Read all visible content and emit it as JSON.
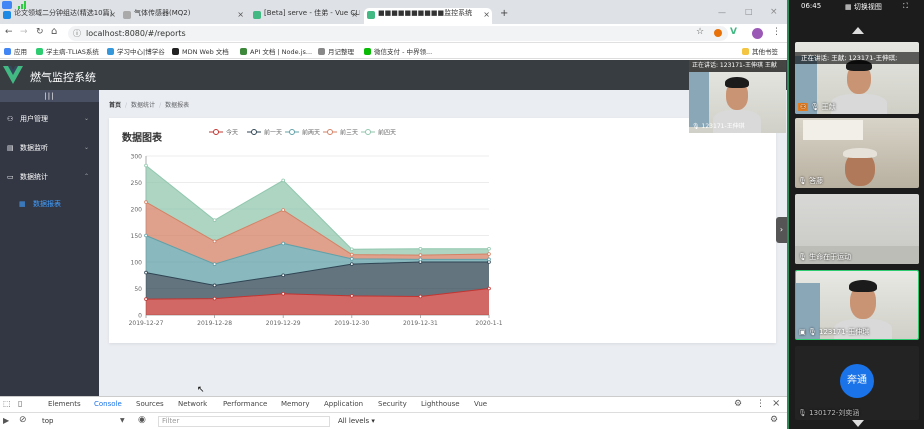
{
  "browser": {
    "tabs": [
      {
        "label": "论文领域二分钟组达(精选10篇)"
      },
      {
        "label": "气体传感器(MQ2)"
      },
      {
        "label": "[Beta] serve - 佳弟 - Vue CLI"
      },
      {
        "label": "■■■■■■■■■■监控系统"
      }
    ],
    "new_tab": "+",
    "url": "localhost:8080/#/reports",
    "bookmarks": [
      "应用",
      "学主病-TLIAS系统",
      "学习中心|博学谷",
      "MDN Web 文档",
      "API 文档 | Node.js...",
      "月记整理",
      "微信支付 - 中界领...",
      "其他书签"
    ]
  },
  "app": {
    "title": "燃气监控系统",
    "collapse_label": "|||",
    "menu": [
      {
        "label": "用户管理",
        "icon": "user-icon"
      },
      {
        "label": "数据监听",
        "icon": "document-icon"
      },
      {
        "label": "数据统计",
        "icon": "chat-icon"
      }
    ],
    "submenu_active": "数据报表",
    "breadcrumb": [
      "首页",
      "数据统计",
      "数据报表"
    ],
    "card_title": "数据图表"
  },
  "chart_data": {
    "type": "area",
    "title": "数据图表",
    "stacked": true,
    "categories": [
      "2019-12-27",
      "2019-12-28",
      "2019-12-29",
      "2019-12-30",
      "2019-12-31",
      "2020-1-1"
    ],
    "ylim": [
      0,
      300
    ],
    "yticks": [
      0,
      50,
      100,
      150,
      200,
      250,
      300
    ],
    "legend_position": "top-center",
    "series": [
      {
        "name": "今天",
        "color": "#c23531",
        "values": [
          30,
          31,
          40,
          36,
          35,
          50
        ]
      },
      {
        "name": "前一天",
        "color": "#2f4554",
        "values": [
          50,
          25,
          35,
          60,
          65,
          50
        ]
      },
      {
        "name": "前两天",
        "color": "#61a0a8",
        "values": [
          70,
          40,
          60,
          10,
          5,
          5
        ]
      },
      {
        "name": "前三天",
        "color": "#d48265",
        "values": [
          63,
          43,
          63,
          8,
          8,
          10
        ]
      },
      {
        "name": "前四天",
        "color": "#91c7ae",
        "values": [
          69,
          40,
          56,
          10,
          12,
          10
        ]
      }
    ]
  },
  "devtools": {
    "tabs": [
      "Elements",
      "Console",
      "Sources",
      "Network",
      "Performance",
      "Memory",
      "Application",
      "Security",
      "Lighthouse",
      "Vue"
    ],
    "active_tab": "Console",
    "context": "top",
    "filter_placeholder": "Filter",
    "levels": "All levels ▾"
  },
  "meeting": {
    "clock": "06:45",
    "switch_view": "切换视图",
    "speaking_banner": "正在讲话: 123171-王伸琪 王献",
    "floating_caption": "123171-王伸琪",
    "participants": [
      {
        "name": "正在讲话: 王献; 123171-王伸琪;"
      },
      {
        "name": "王献"
      },
      {
        "name": "答藤"
      },
      {
        "name": "生命在于运动"
      },
      {
        "name": "123171-王伸琪"
      },
      {
        "name": "130172-刘奕涵"
      }
    ],
    "avatar_text": "奔通"
  }
}
